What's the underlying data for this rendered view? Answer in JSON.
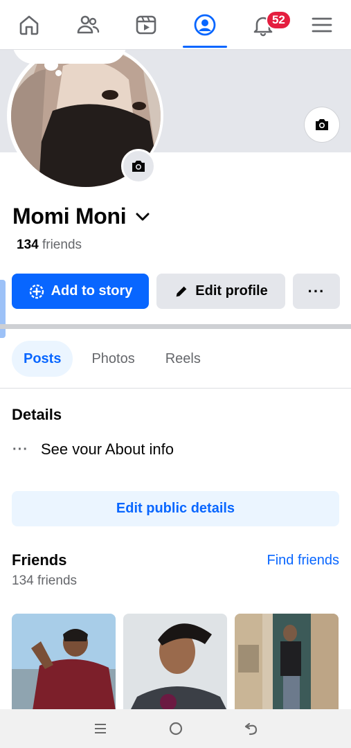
{
  "topnav": {
    "tabs": [
      {
        "name": "home",
        "icon": "home-icon"
      },
      {
        "name": "friends",
        "icon": "friends-icon"
      },
      {
        "name": "video",
        "icon": "video-icon"
      },
      {
        "name": "profile",
        "icon": "profile-icon",
        "active": true
      },
      {
        "name": "notifications",
        "icon": "bell-icon",
        "badge": "52"
      },
      {
        "name": "menu",
        "icon": "hamburger-icon"
      }
    ],
    "notification_badge": "52",
    "accent_color": "#0866ff"
  },
  "profile": {
    "name": "Momi Moni",
    "friends_count": "134",
    "friends_suffix": " friends"
  },
  "actions": {
    "add_story": "Add to story",
    "edit_profile": "Edit profile",
    "more": "···"
  },
  "tabs": [
    {
      "label": "Posts",
      "active": true
    },
    {
      "label": "Photos"
    },
    {
      "label": "Reels"
    }
  ],
  "details": {
    "title": "Details",
    "about_dots": "···",
    "about_text": "See vour About info",
    "edit_public": "Edit public details"
  },
  "friends_section": {
    "title": "Friends",
    "find_friends": "Find friends",
    "count_label": "134 friends"
  }
}
